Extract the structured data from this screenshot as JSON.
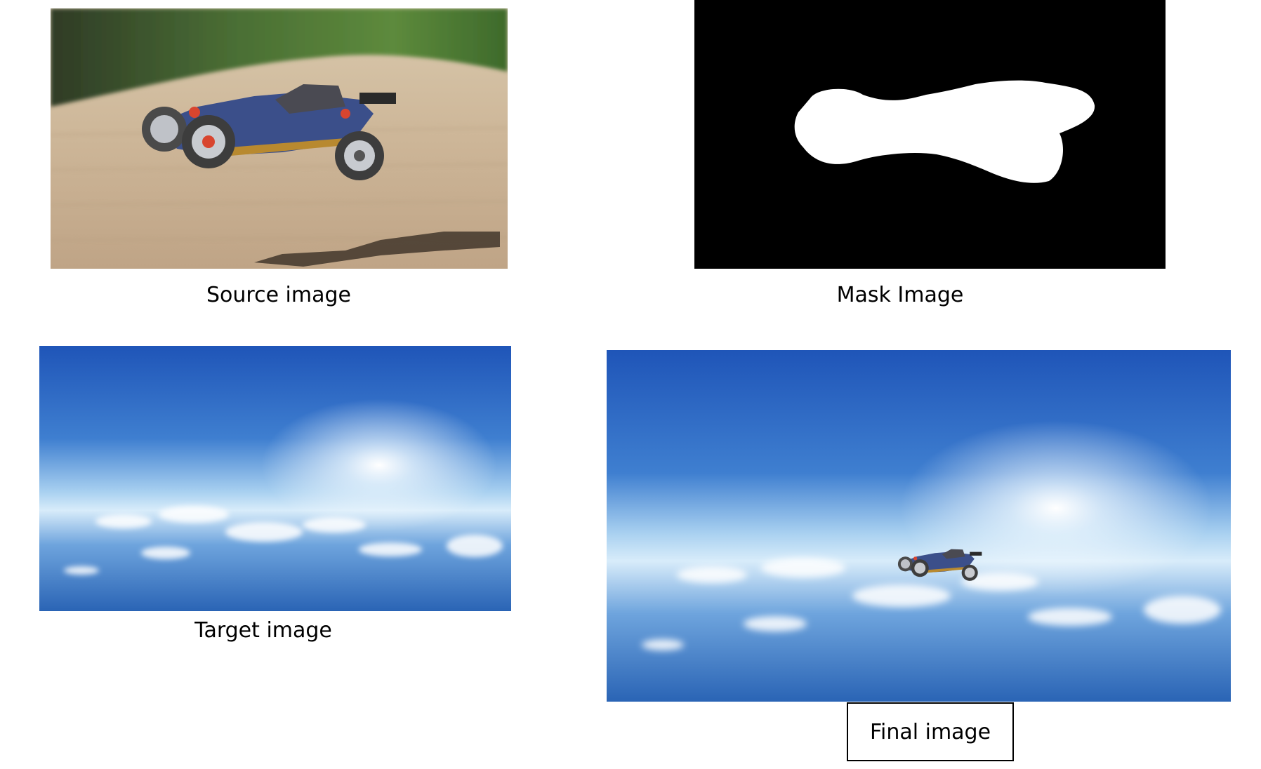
{
  "figure": {
    "panels": [
      {
        "key": "source",
        "caption": "Source image",
        "icon": "rc-buggy-photo-icon"
      },
      {
        "key": "mask",
        "caption": "Mask Image",
        "icon": "binary-mask-icon"
      },
      {
        "key": "target",
        "caption": "Target image",
        "icon": "earth-horizon-sky-icon"
      },
      {
        "key": "final",
        "caption": "Final image",
        "icon": "composite-buggy-in-sky-icon",
        "caption_boxed": true
      }
    ]
  },
  "colors": {
    "sky_top": "#1f55b8",
    "sky_mid": "#4f8fd6",
    "horizon": "#cfe6f8",
    "ocean": "#2f6fc0",
    "ground": "#cbb69a",
    "foliage": "#3f6a2e",
    "mask_fg": "#ffffff",
    "mask_bg": "#000000",
    "buggy_body": "#3b4f8a",
    "buggy_accent": "#d8452f",
    "buggy_frame": "#b8892f"
  }
}
